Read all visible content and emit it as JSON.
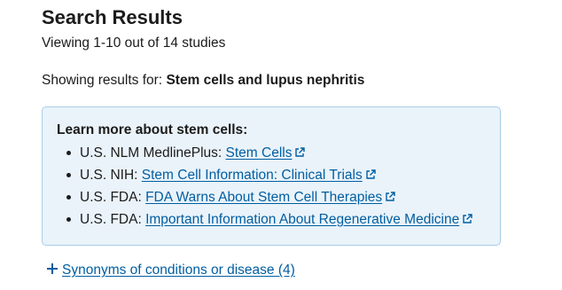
{
  "header": {
    "title": "Search Results",
    "count_text": "Viewing 1-10 out of 14 studies"
  },
  "query": {
    "prefix": "Showing results for: ",
    "term": "Stem cells and lupus nephritis"
  },
  "info_box": {
    "heading": "Learn more about stem cells:",
    "items": [
      {
        "source": "U.S. NLM MedlinePlus: ",
        "link": "Stem Cells"
      },
      {
        "source": "U.S. NIH: ",
        "link": "Stem Cell Information: Clinical Trials"
      },
      {
        "source": "U.S. FDA: ",
        "link": "FDA Warns About Stem Cell Therapies"
      },
      {
        "source": "U.S. FDA: ",
        "link": "Important Information About Regenerative Medicine"
      }
    ],
    "link_icon": "external-link-icon"
  },
  "synonyms": {
    "icon": "plus-icon",
    "label": "Synonyms of conditions or disease (4)"
  },
  "colors": {
    "link": "#005ea2",
    "box_background": "#eaf3fa",
    "box_border": "#a9cde9",
    "text": "#1b1b1b"
  }
}
